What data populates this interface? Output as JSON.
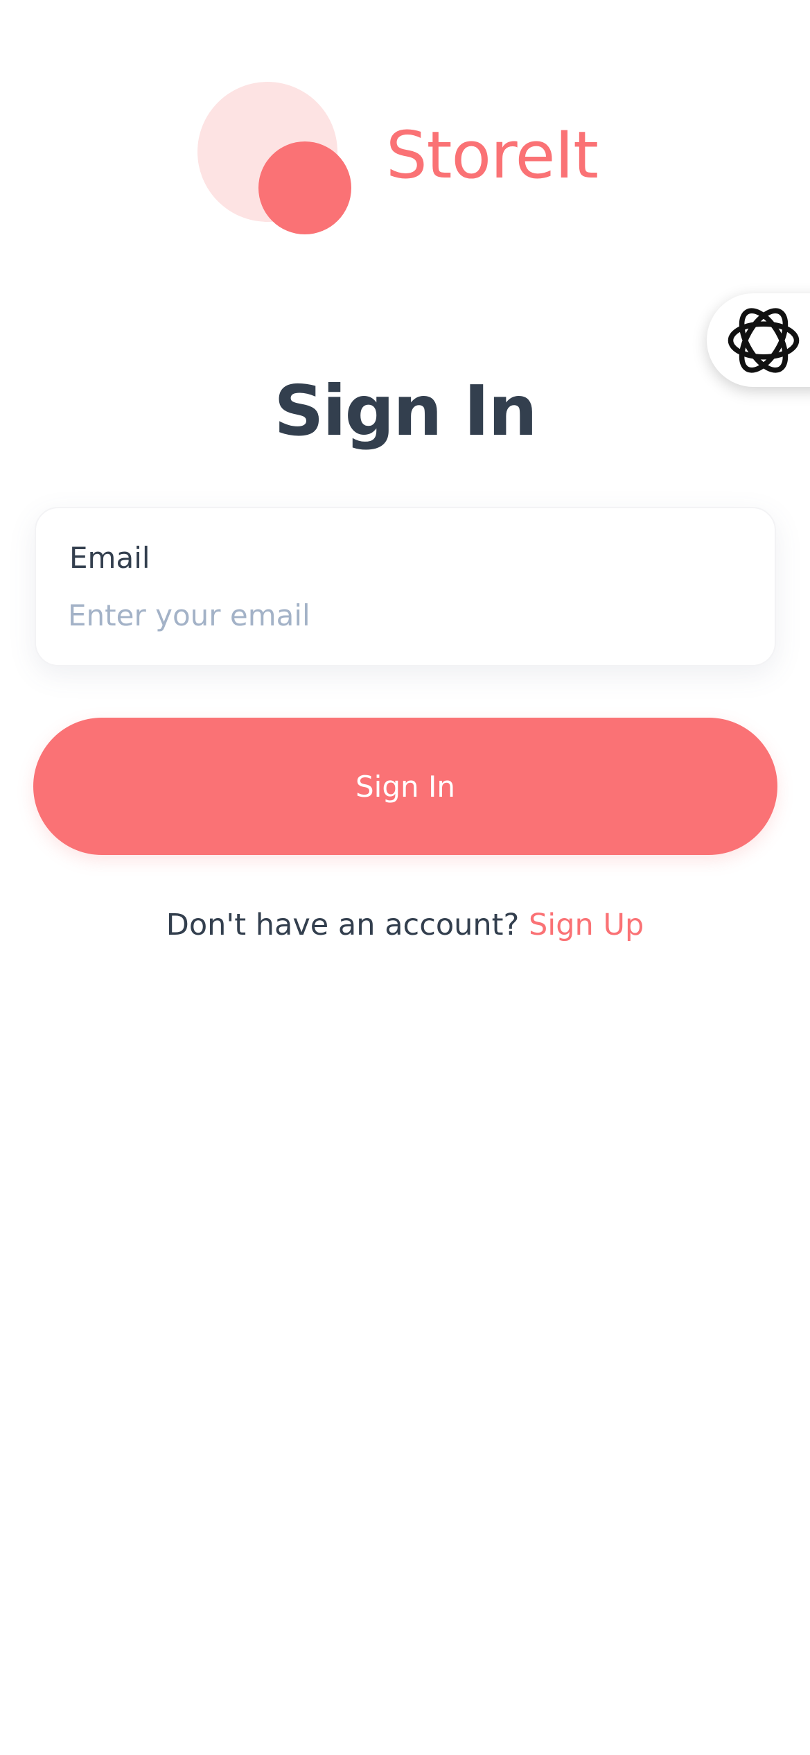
{
  "brand": {
    "name": "StoreIt",
    "accent_color": "#fa7275",
    "accent_light_color": "#fde3e3"
  },
  "floating_action": {
    "icon": "ai-assistant-icon"
  },
  "form": {
    "title": "Sign In",
    "email": {
      "label": "Email",
      "placeholder": "Enter your email",
      "value": ""
    },
    "submit_label": "Sign In"
  },
  "footer": {
    "prompt": "Don't have an account?",
    "link_label": "Sign Up"
  },
  "colors": {
    "text_primary": "#333f4e",
    "placeholder": "#a3b2c7",
    "background": "#ffffff"
  }
}
